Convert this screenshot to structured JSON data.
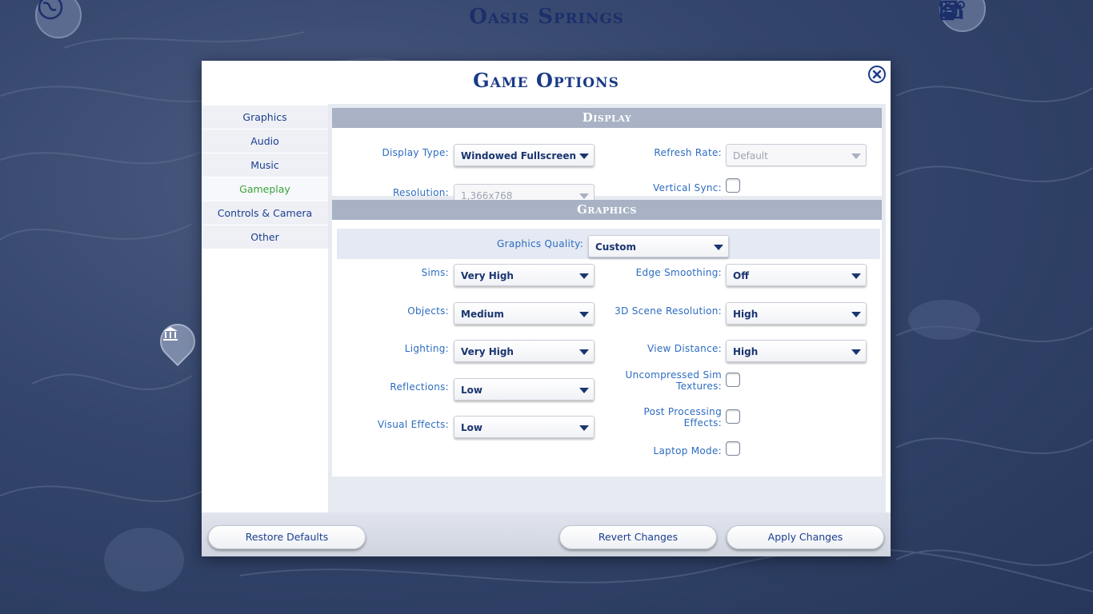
{
  "world": {
    "title": "Oasis Springs"
  },
  "dialog": {
    "title": "Game Options",
    "close_label": "×"
  },
  "sidebar": {
    "items": [
      {
        "label": "Graphics",
        "active": false
      },
      {
        "label": "Audio",
        "active": false
      },
      {
        "label": "Music",
        "active": false
      },
      {
        "label": "Gameplay",
        "active": true
      },
      {
        "label": "Controls & Camera",
        "active": false
      },
      {
        "label": "Other",
        "active": false
      }
    ]
  },
  "display": {
    "header": "Display",
    "display_type": {
      "label": "Display Type:",
      "value": "Windowed Fullscreen"
    },
    "refresh_rate": {
      "label": "Refresh Rate:",
      "value": "Default"
    },
    "resolution": {
      "label": "Resolution:",
      "value": "1,366x768"
    },
    "vertical_sync": {
      "label": "Vertical Sync:",
      "checked": false
    }
  },
  "graphics": {
    "header": "Graphics",
    "quality": {
      "label": "Graphics Quality:",
      "value": "Custom"
    },
    "sims": {
      "label": "Sims:",
      "value": "Very High"
    },
    "objects": {
      "label": "Objects:",
      "value": "Medium"
    },
    "lighting": {
      "label": "Lighting:",
      "value": "Very High"
    },
    "reflections": {
      "label": "Reflections:",
      "value": "Low"
    },
    "visual_effects": {
      "label": "Visual Effects:",
      "value": "Low"
    },
    "edge_smoothing": {
      "label": "Edge Smoothing:",
      "value": "Off"
    },
    "scene_resolution": {
      "label": "3D Scene Resolution:",
      "value": "High"
    },
    "view_distance": {
      "label": "View Distance:",
      "value": "High"
    },
    "uncompressed_textures": {
      "label_line1": "Uncompressed Sim",
      "label_line2": "Textures:",
      "checked": false
    },
    "post_processing": {
      "label_line1": "Post Processing",
      "label_line2": "Effects:",
      "checked": false
    },
    "laptop_mode": {
      "label": "Laptop Mode:",
      "checked": false
    }
  },
  "footer": {
    "restore_defaults": "Restore Defaults",
    "revert_changes": "Revert Changes",
    "apply_changes": "Apply Changes"
  },
  "colors": {
    "accent_blue": "#1a3a86",
    "label_blue": "#2d6cc0",
    "active_green": "#3aa33a",
    "section_header": "#a8b2c4"
  }
}
